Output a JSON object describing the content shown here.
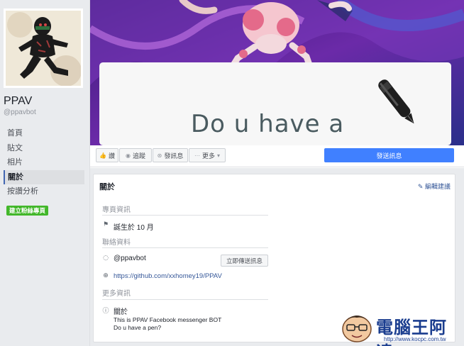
{
  "page": {
    "name": "PPAV",
    "handle": "@ppavbot"
  },
  "sidebar": {
    "items": [
      {
        "label": "首頁"
      },
      {
        "label": "貼文"
      },
      {
        "label": "相片"
      },
      {
        "label": "關於"
      },
      {
        "label": "按讚分析"
      }
    ],
    "active_index": 3,
    "create_page_label": "建立粉絲專頁"
  },
  "cover": {
    "text": "Do u have a"
  },
  "actions": {
    "like": "讚",
    "follow": "追蹤",
    "share": "發訊息",
    "more": "更多",
    "send_message": "發送訊息"
  },
  "about": {
    "title": "關於",
    "edit": "編輯建議",
    "sections": {
      "page_info": "專頁資訊",
      "contact": "聯絡資料",
      "more_info": "更多資訊"
    },
    "birthday": "誕生於 10 月",
    "messenger": "@ppavbot",
    "send_now": "立即傳送訊息",
    "website": "https://github.com/xxhomey19/PPAV",
    "about_label": "關於",
    "desc_line1": "This is PPAV Facebook messenger BOT",
    "desc_line2": "Do u have a pen?"
  },
  "watermark": {
    "text": "電腦王阿達",
    "url": "http://www.kocpc.com.tw"
  },
  "colors": {
    "facebook_blue": "#4080ff",
    "create_green": "#42b72a",
    "link_blue": "#365899",
    "sidebar_bg": "#e9ebee"
  }
}
